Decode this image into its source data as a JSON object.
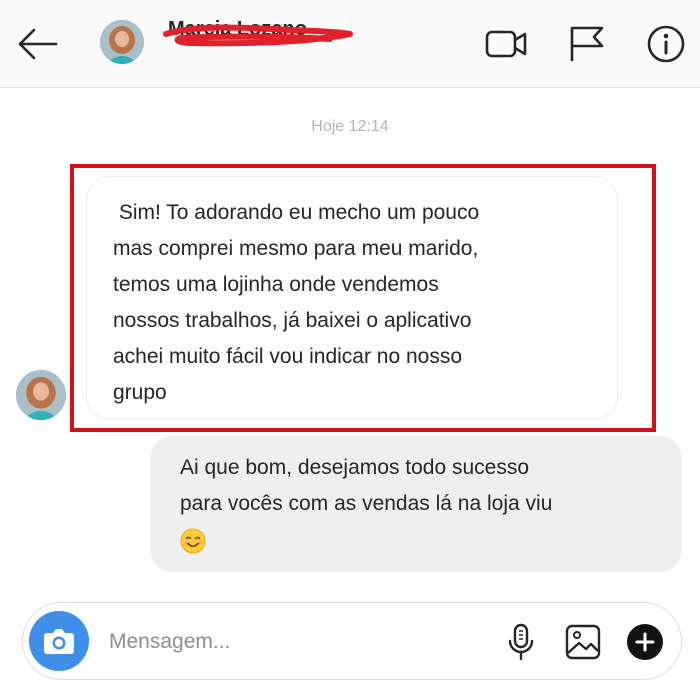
{
  "header": {
    "contact_name": "Marcia Lozano",
    "icons": [
      "back-arrow-icon",
      "video-call-icon",
      "flag-icon",
      "info-icon"
    ]
  },
  "thread": {
    "timestamp": "Hoje 12:14",
    "messages": [
      {
        "direction": "received",
        "lines": [
          " Sim! To adorando eu mecho um pouco",
          "mas comprei mesmo para meu marido,",
          "temos uma lojinha onde vendemos",
          "nossos trabalhos, já baixei o aplicativo",
          "achei muito fácil vou indicar no nosso",
          "grupo"
        ]
      },
      {
        "direction": "sent",
        "lines": [
          "Ai que bom, desejamos todo sucesso",
          "para vocês com as vendas lá na loja viu"
        ],
        "emoji": "smiling-face-emoji"
      }
    ]
  },
  "composer": {
    "placeholder": "Mensagem...",
    "icons": [
      "camera-icon",
      "microphone-icon",
      "gallery-icon",
      "plus-icon"
    ]
  },
  "colors": {
    "highlight_border": "#d0121c",
    "camera_button": "#3f8fe8",
    "sent_bubble": "#efefef",
    "redaction_scribble": "#e0212b"
  }
}
